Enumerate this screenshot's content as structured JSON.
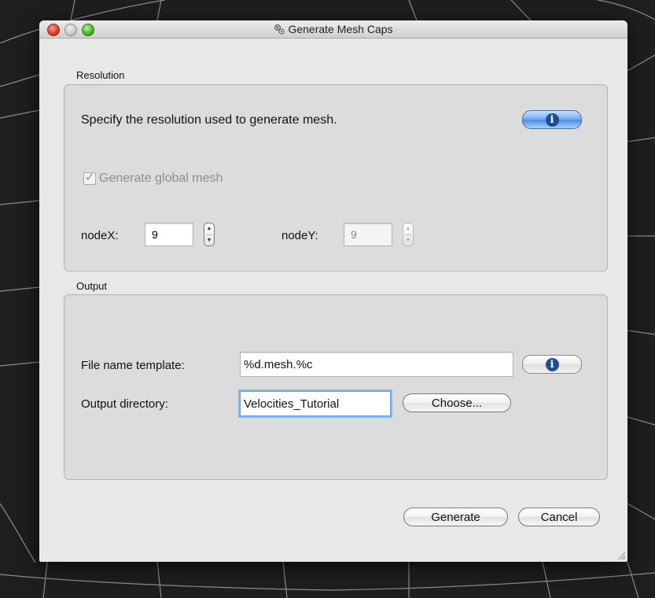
{
  "window": {
    "title": "Generate Mesh Caps",
    "title_icon": "gears-icon"
  },
  "resolution": {
    "label": "Resolution",
    "description": "Specify the resolution used to generate mesh.",
    "info_icon": "info-icon",
    "global_mesh": {
      "label": "Generate global mesh",
      "checked": true,
      "enabled": false
    },
    "node_x": {
      "label": "nodeX:",
      "value": "9"
    },
    "node_y": {
      "label": "nodeY:",
      "value": "9"
    }
  },
  "output": {
    "label": "Output",
    "file_name_template": {
      "label": "File name template:",
      "value": "%d.mesh.%c"
    },
    "output_directory": {
      "label": "Output directory:",
      "value": "Velocities_Tutorial"
    },
    "choose_label": "Choose..."
  },
  "footer": {
    "generate_label": "Generate",
    "cancel_label": "Cancel"
  },
  "colors": {
    "info_button_blue": "#6fa8f0",
    "close_red": "#e0342a",
    "maximize_green": "#3fb41f"
  }
}
